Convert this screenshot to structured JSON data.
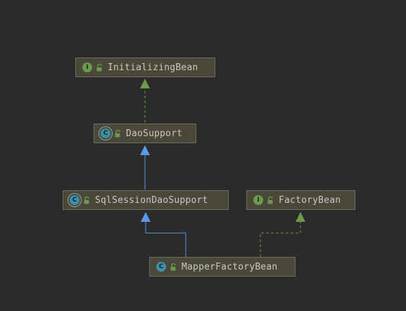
{
  "diagram": {
    "nodes": [
      {
        "id": "initializing-bean",
        "label": "InitializingBean",
        "kind": "I",
        "icon": "interface-icon"
      },
      {
        "id": "dao-support",
        "label": "DaoSupport",
        "kind": "C",
        "icon": "abstract-class-icon"
      },
      {
        "id": "sql-session-dao-support",
        "label": "SqlSessionDaoSupport",
        "kind": "C",
        "icon": "abstract-class-icon"
      },
      {
        "id": "factory-bean",
        "label": "FactoryBean",
        "kind": "I",
        "icon": "interface-icon"
      },
      {
        "id": "mapper-factory-bean",
        "label": "MapperFactoryBean",
        "kind": "C",
        "icon": "class-icon"
      }
    ],
    "edges": [
      {
        "from": "dao-support",
        "to": "initializing-bean",
        "type": "implements"
      },
      {
        "from": "sql-session-dao-support",
        "to": "dao-support",
        "type": "extends"
      },
      {
        "from": "mapper-factory-bean",
        "to": "sql-session-dao-support",
        "type": "extends"
      },
      {
        "from": "mapper-factory-bean",
        "to": "factory-bean",
        "type": "implements"
      }
    ],
    "colors": {
      "background": "#2b2b2b",
      "node_fill": "#4a4838",
      "node_border": "#6e6d5f",
      "extends_edge": "#5a9ae8",
      "implements_edge": "#6a9a4a",
      "text": "#c8c8c8"
    }
  }
}
